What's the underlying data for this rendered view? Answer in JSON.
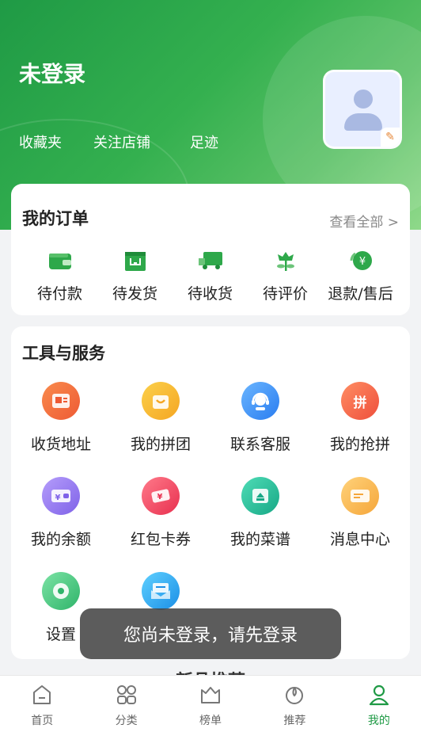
{
  "header": {
    "user_name": "未登录",
    "links": [
      "收藏夹",
      "关注店铺",
      "足迹"
    ]
  },
  "orders": {
    "title": "我的订单",
    "view_all": "查看全部 >",
    "items": [
      {
        "label": "待付款",
        "icon": "wallet-icon"
      },
      {
        "label": "待发货",
        "icon": "box-icon"
      },
      {
        "label": "待收货",
        "icon": "truck-icon"
      },
      {
        "label": "待评价",
        "icon": "flower-icon"
      },
      {
        "label": "退款/售后",
        "icon": "refund-icon"
      }
    ]
  },
  "tools": {
    "title": "工具与服务",
    "items": [
      {
        "label": "收货地址",
        "icon": "address-icon",
        "color": "#f26a3d"
      },
      {
        "label": "我的拼团",
        "icon": "group-buy-icon",
        "color": "#f7b62f"
      },
      {
        "label": "联系客服",
        "icon": "customer-service-icon",
        "color": "#3a8df5"
      },
      {
        "label": "我的抢拼",
        "icon": "rush-buy-icon",
        "color": "#f06b4a"
      },
      {
        "label": "我的余额",
        "icon": "balance-icon",
        "color": "#9a7ef0"
      },
      {
        "label": "红包卡券",
        "icon": "coupon-icon",
        "color": "#f24d6a"
      },
      {
        "label": "我的菜谱",
        "icon": "recipe-icon",
        "color": "#25c2a0"
      },
      {
        "label": "消息中心",
        "icon": "message-icon",
        "color": "#f7b84a"
      },
      {
        "label": "设置",
        "icon": "settings-icon",
        "color": "#4cc48a"
      },
      {
        "label": "",
        "icon": "mail-icon",
        "color": "#33b3f0"
      }
    ]
  },
  "recommend_title": "新品推荐",
  "toast": "您尚未登录，请先登录",
  "tabbar": [
    {
      "label": "首页",
      "icon": "home-icon"
    },
    {
      "label": "分类",
      "icon": "category-icon"
    },
    {
      "label": "榜单",
      "icon": "ranking-icon"
    },
    {
      "label": "推荐",
      "icon": "recommend-icon"
    },
    {
      "label": "我的",
      "icon": "profile-icon",
      "active": true
    }
  ]
}
